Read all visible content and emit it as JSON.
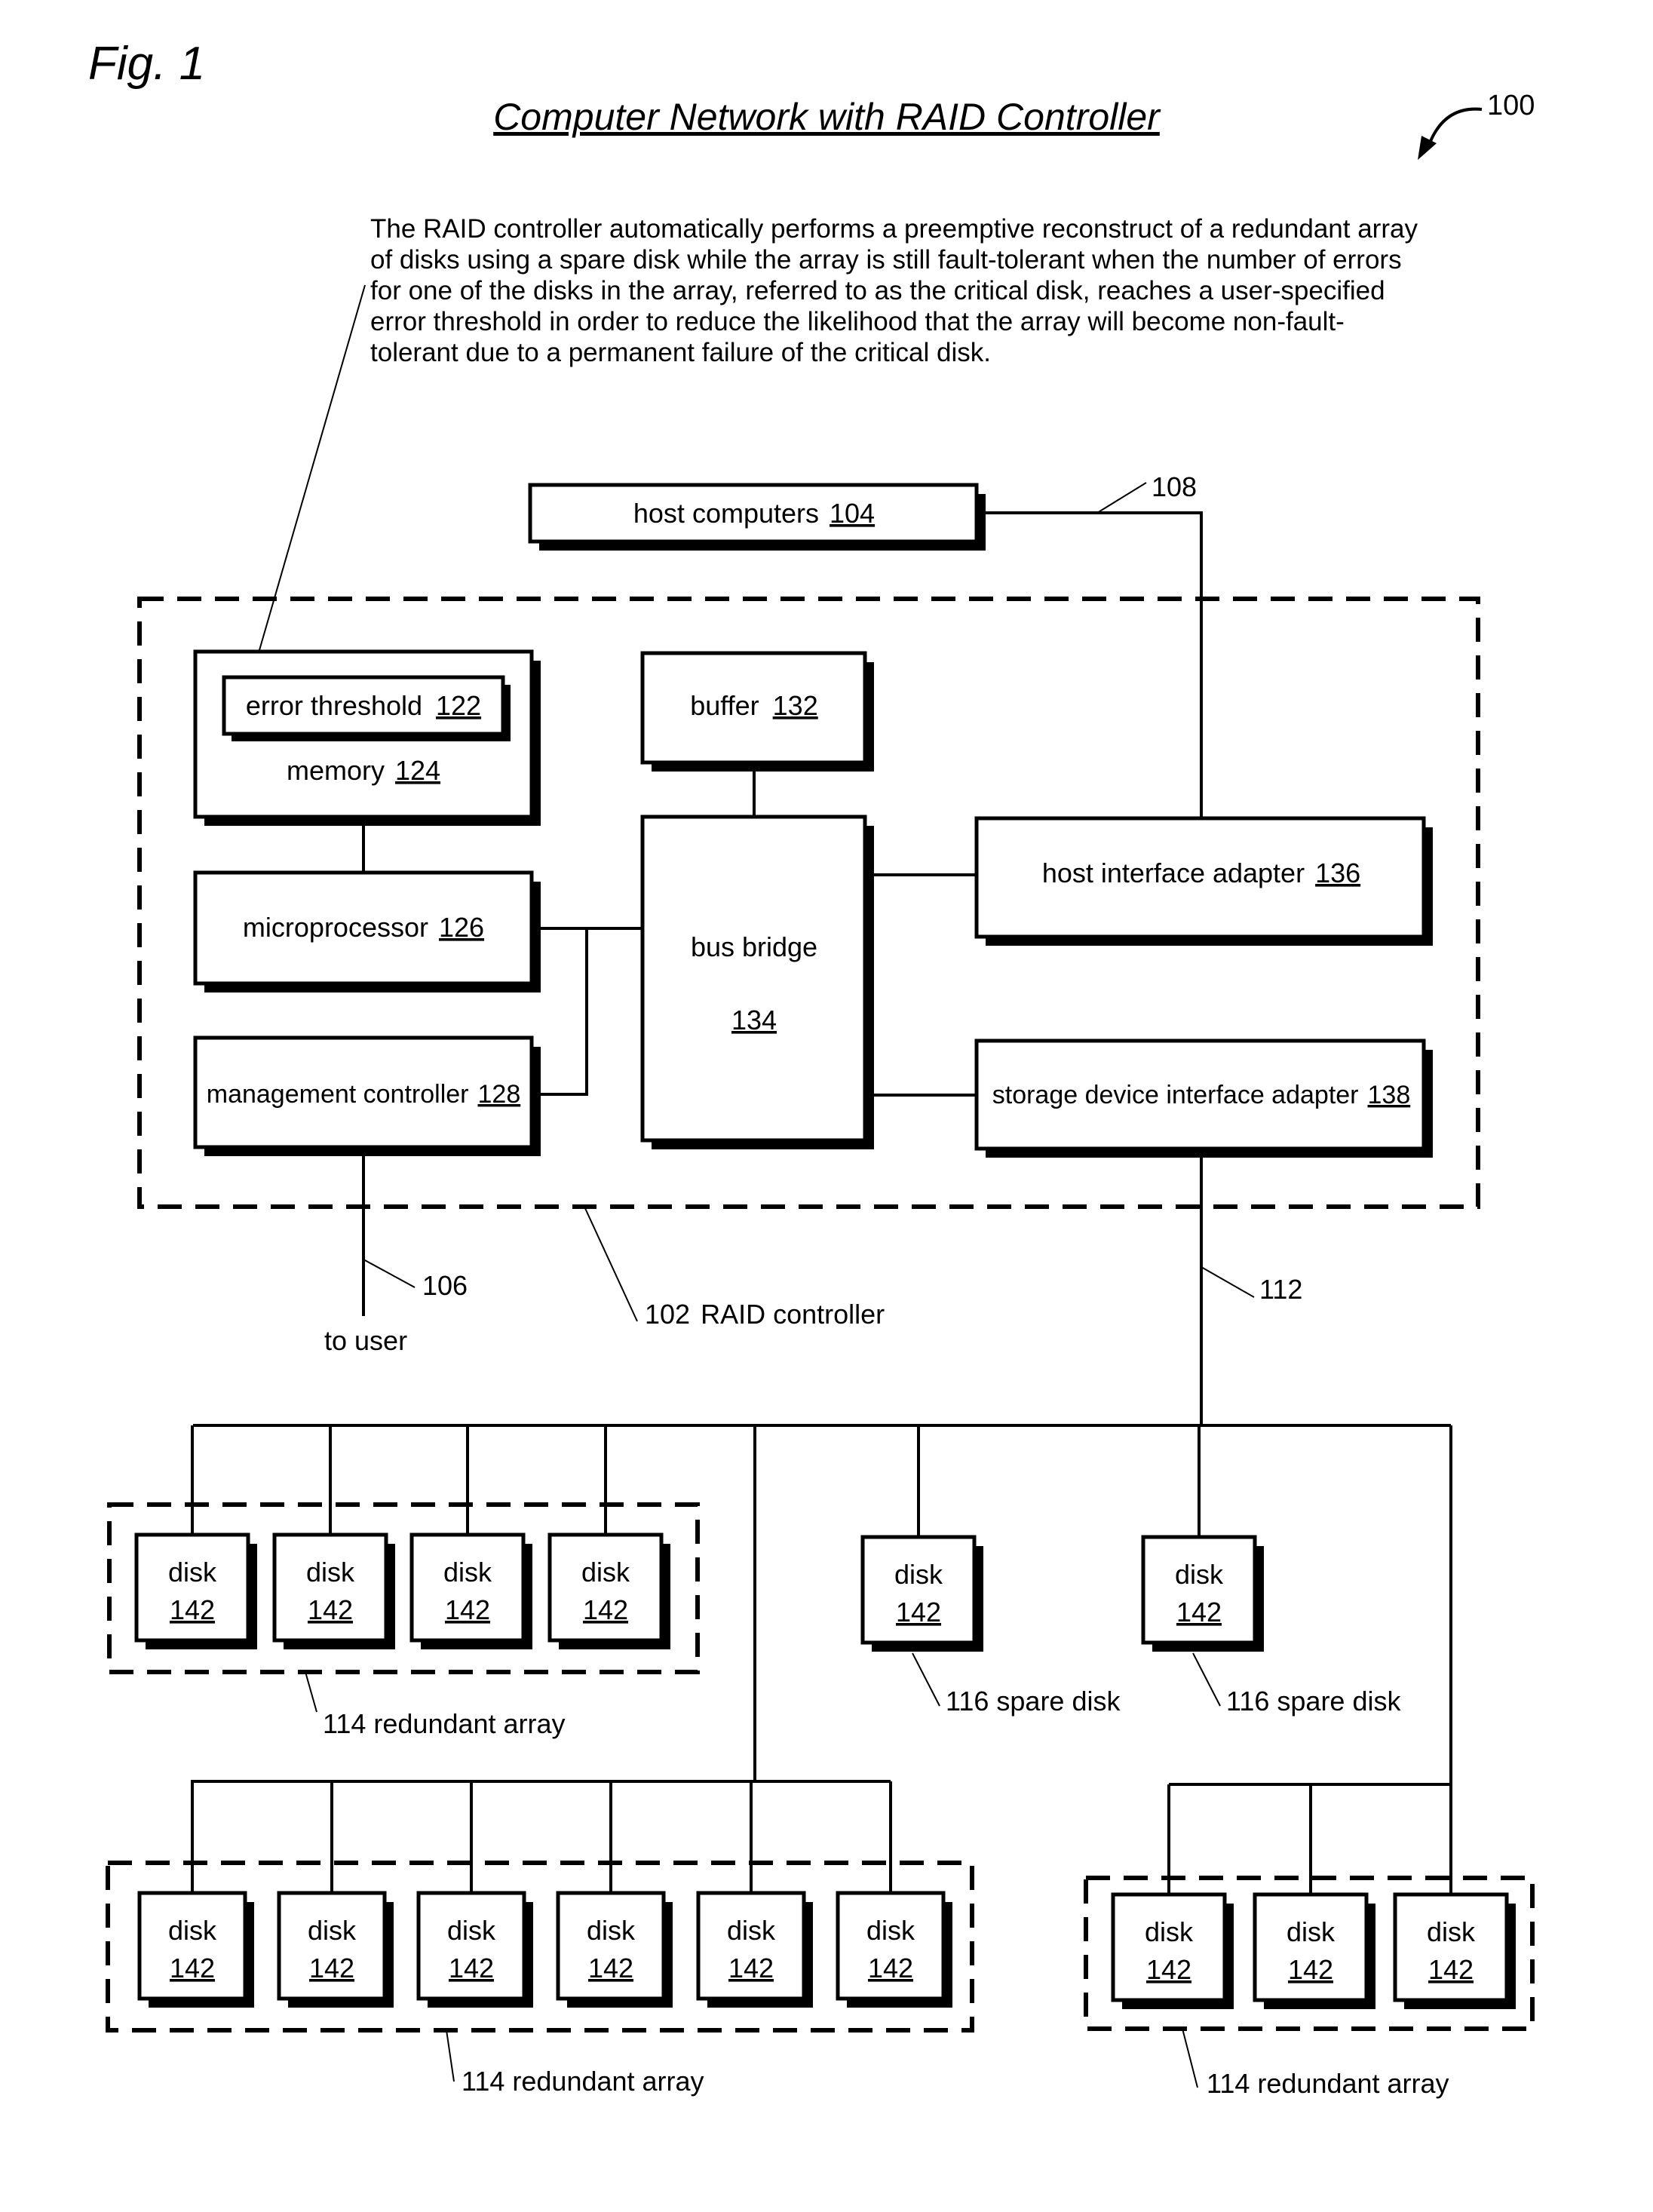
{
  "figure": {
    "label": "Fig. 1",
    "title": "Computer Network with RAID Controller",
    "ref": "100"
  },
  "annotation": {
    "lines": [
      "The RAID controller automatically performs a preemptive reconstruct of a redundant array",
      "of disks using a spare disk while the array is still fault-tolerant when the number of errors",
      "for one of the disks in the array, referred to as the critical disk, reaches a user-specified",
      "error threshold in order to reduce the likelihood that the array will become non-fault-",
      "tolerant due to a permanent failure of the critical disk."
    ]
  },
  "blocks": {
    "host_computers": {
      "label": "host computers",
      "ref": "104"
    },
    "error_threshold": {
      "label": "error threshold",
      "ref": "122"
    },
    "memory": {
      "label": "memory",
      "ref": "124"
    },
    "buffer": {
      "label": "buffer",
      "ref": "132"
    },
    "bus_bridge": {
      "label": "bus bridge",
      "ref": "134"
    },
    "host_interface_adapter": {
      "label": "host interface adapter",
      "ref": "136"
    },
    "microprocessor": {
      "label": "microprocessor",
      "ref": "126"
    },
    "management_controller": {
      "label": "management controller",
      "ref": "128"
    },
    "storage_device_interface_adapter": {
      "label": "storage device interface adapter",
      "ref": "138"
    }
  },
  "connections": {
    "host_link": "108",
    "user_link": "106",
    "user_link_label": "to user",
    "storage_link": "112"
  },
  "raid_controller": {
    "ref": "102",
    "label": "RAID controller"
  },
  "disk": {
    "label": "disk",
    "ref": "142"
  },
  "arrays": [
    {
      "ref": "114",
      "label": "redundant array",
      "disk_count": 4
    },
    {
      "ref": "114",
      "label": "redundant array",
      "disk_count": 6
    },
    {
      "ref": "114",
      "label": "redundant array",
      "disk_count": 3
    }
  ],
  "spares": [
    {
      "ref": "116",
      "label": "spare disk"
    },
    {
      "ref": "116",
      "label": "spare disk"
    }
  ]
}
